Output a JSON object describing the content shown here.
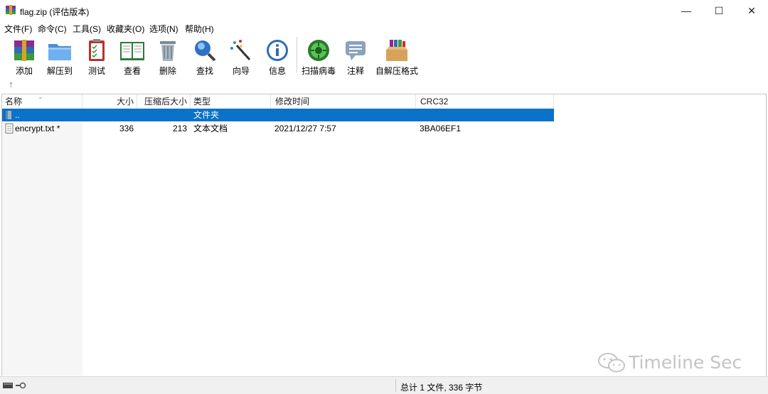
{
  "window": {
    "title": "flag.zip (评估版本)",
    "minimize": "—",
    "maximize": "☐",
    "close": "✕"
  },
  "menu": [
    "文件(F)",
    "命令(C)",
    "工具(S)",
    "收藏夹(O)",
    "选项(N)",
    "帮助(H)"
  ],
  "toolbar": [
    {
      "label": "添加",
      "icon": "add-archive-icon"
    },
    {
      "label": "解压到",
      "icon": "extract-folder-icon"
    },
    {
      "label": "测试",
      "icon": "test-clipboard-icon"
    },
    {
      "label": "查看",
      "icon": "view-book-icon"
    },
    {
      "label": "删除",
      "icon": "trash-icon"
    },
    {
      "label": "查找",
      "icon": "magnifier-icon"
    },
    {
      "label": "向导",
      "icon": "wizard-wand-icon"
    },
    {
      "label": "信息",
      "icon": "info-icon"
    },
    {
      "label": "扫描病毒",
      "icon": "virus-scan-icon"
    },
    {
      "label": "注释",
      "icon": "comment-icon"
    },
    {
      "label": "自解压格式",
      "icon": "sfx-box-icon"
    }
  ],
  "address": {
    "up": "↑"
  },
  "columns": [
    "名称",
    "大小",
    "压缩后大小",
    "类型",
    "修改时间",
    "CRC32"
  ],
  "rows": [
    {
      "name": "..",
      "size": "",
      "packed": "",
      "type": "文件夹",
      "modified": "",
      "crc": "",
      "selected": true
    },
    {
      "name": "encrypt.txt *",
      "size": "336",
      "packed": "213",
      "type": "文本文档",
      "modified": "2021/12/27 7:57",
      "crc": "3BA06EF1",
      "selected": false
    }
  ],
  "status": {
    "text": "总计 1 文件, 336 字节"
  },
  "watermark": {
    "text": "Timeline Sec"
  },
  "colors": {
    "selection": "#0a72c8",
    "status_bg": "#f0f0f0"
  }
}
